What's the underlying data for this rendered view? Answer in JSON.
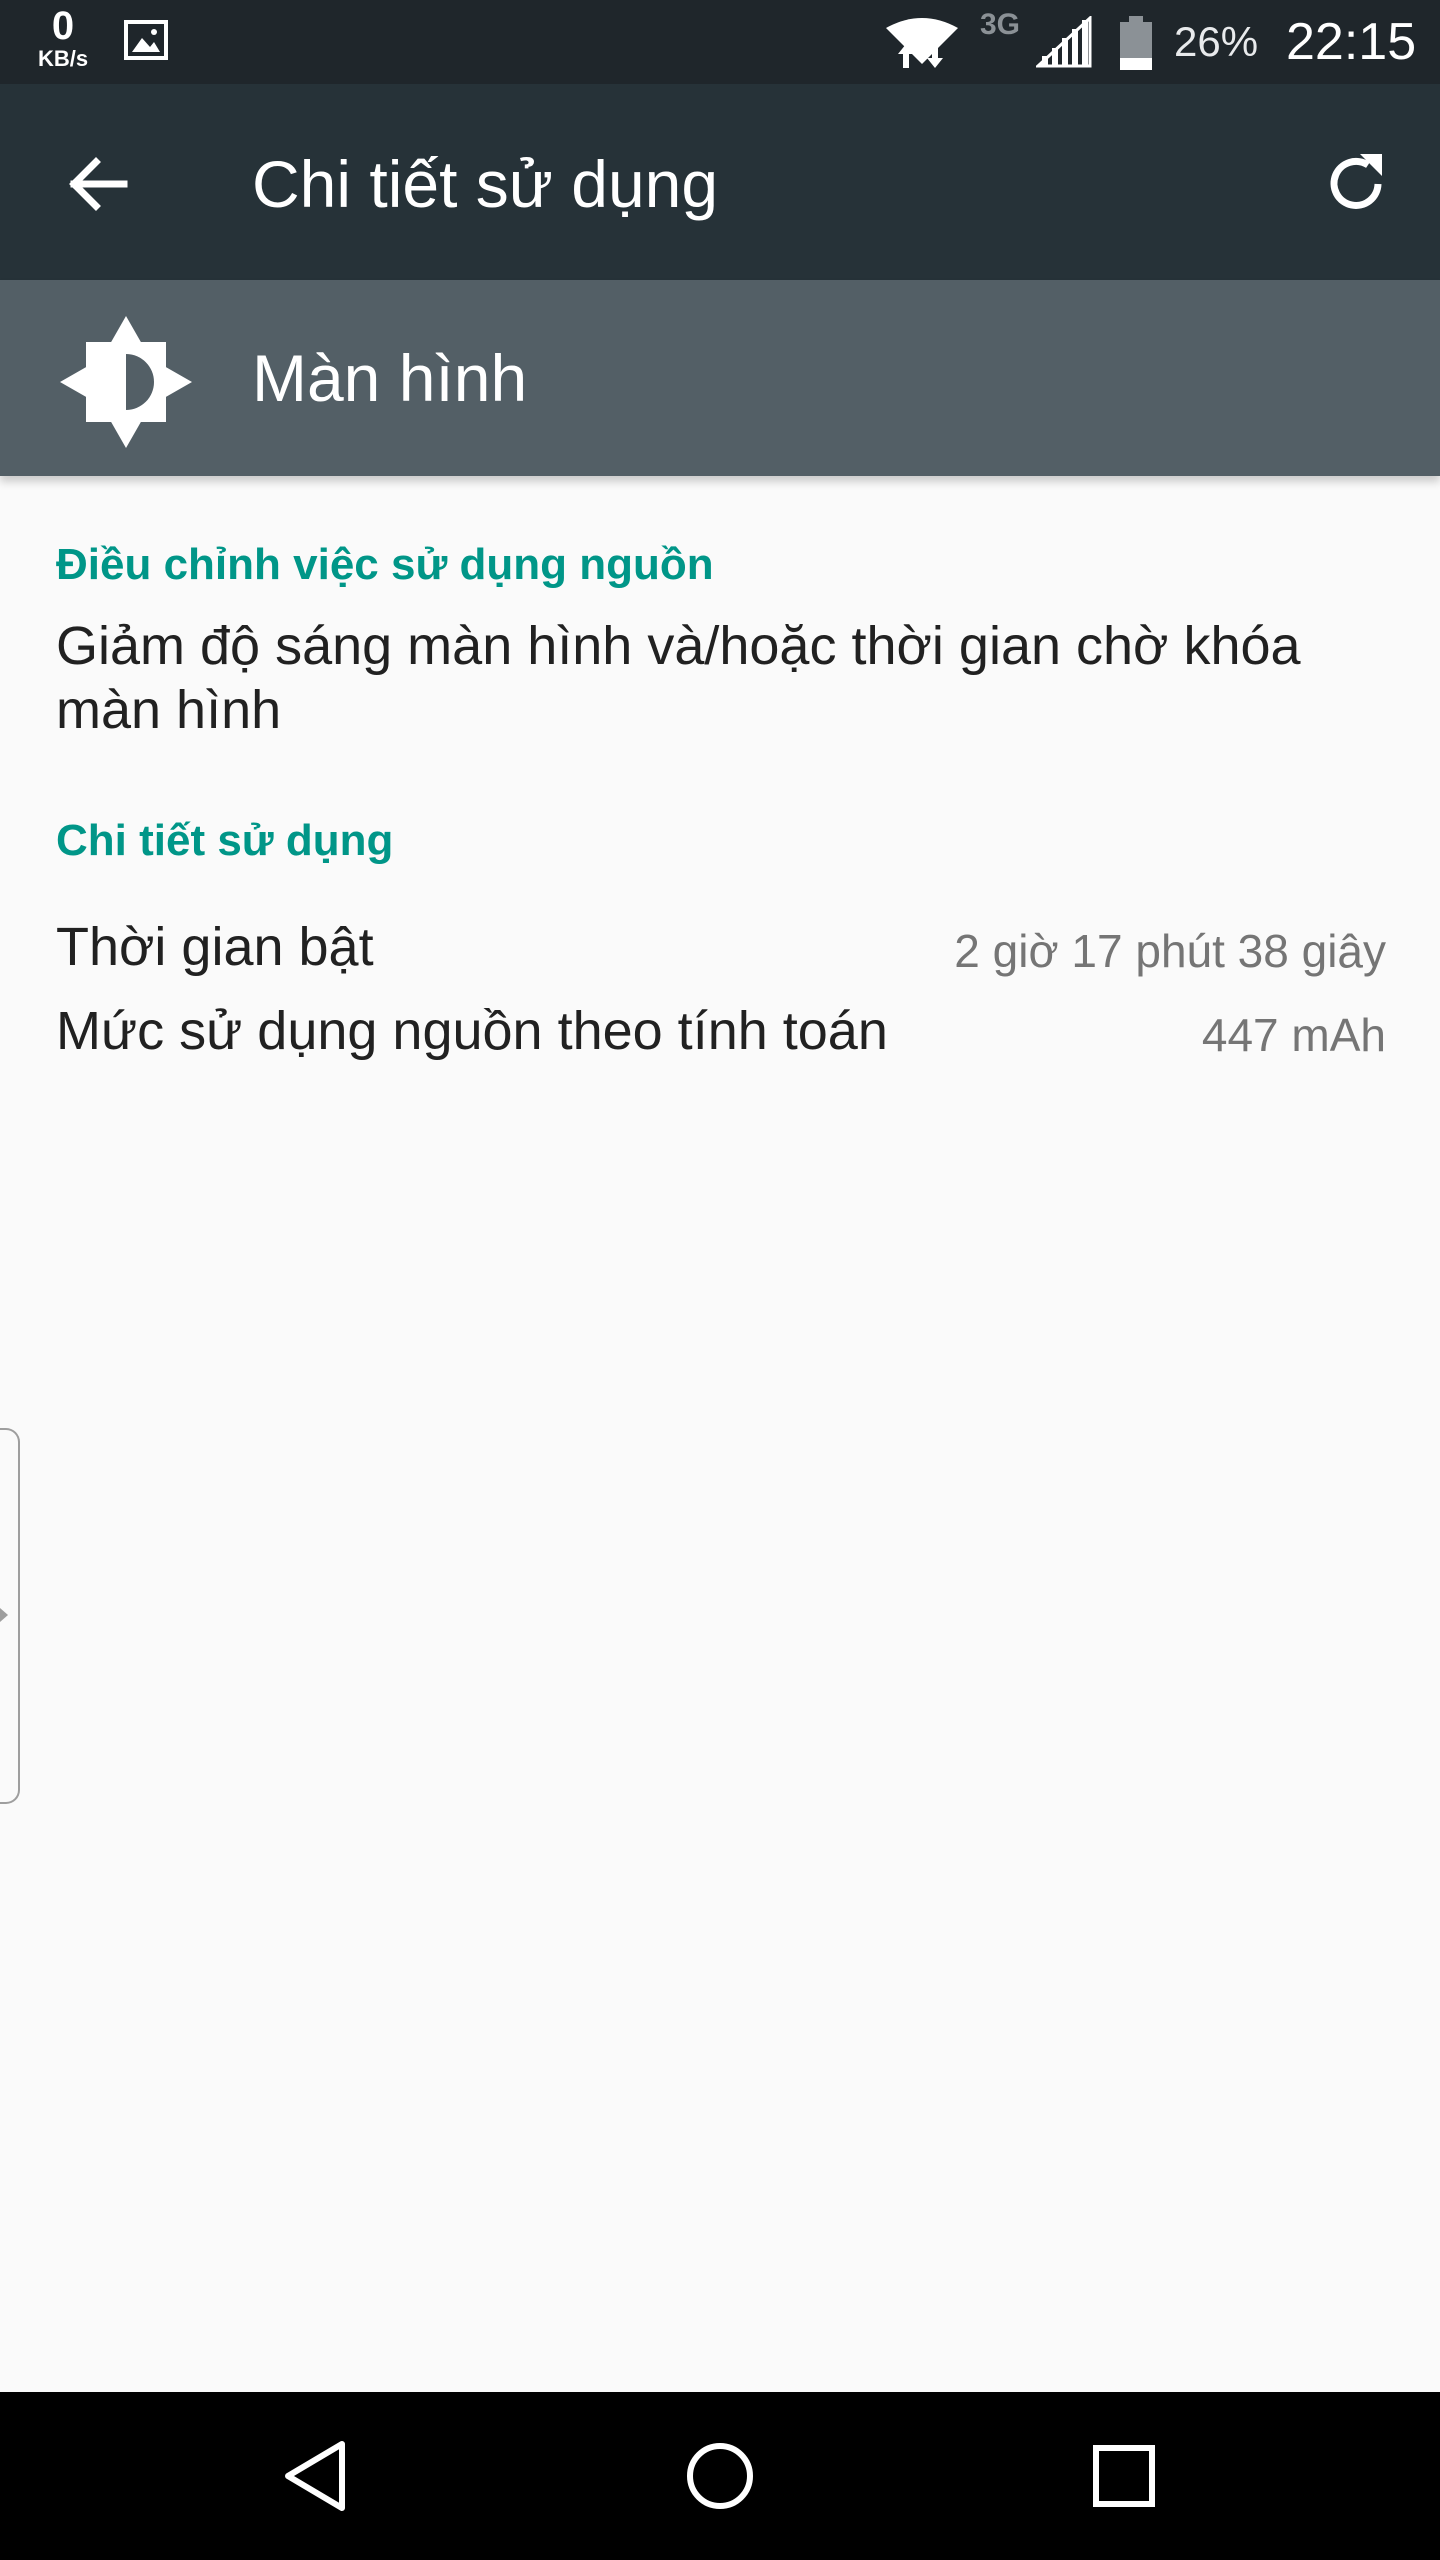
{
  "status_bar": {
    "net_speed_value": "0",
    "net_speed_unit": "KB/s",
    "network_type": "3G",
    "battery_percent": "26%",
    "time": "22:15",
    "icons": [
      "image-notification-icon",
      "wifi-icon",
      "signal-icon",
      "battery-icon"
    ]
  },
  "app_bar": {
    "title": "Chi tiết sử dụng",
    "back_icon": "arrow-back-icon",
    "refresh_icon": "refresh-icon"
  },
  "header": {
    "icon": "brightness-icon",
    "title": "Màn hình"
  },
  "sections": {
    "adjust_title": "Điều chỉnh việc sử dụng nguồn",
    "adjust_text": "Giảm độ sáng màn hình và/hoặc thời gian chờ khóa màn hình",
    "usage_title": "Chi tiết sử dụng",
    "usage_rows": [
      {
        "label": "Thời gian bật",
        "value": "2 giờ 17 phút 38 giây"
      },
      {
        "label": "Mức sử dụng nguồn theo tính toán",
        "value": "447 mAh"
      }
    ]
  },
  "nav_bar": {
    "icons": [
      "nav-back-icon",
      "nav-home-icon",
      "nav-recents-icon"
    ]
  },
  "colors": {
    "status_bar": "#1f262b",
    "app_bar": "#263238",
    "header": "#535f66",
    "accent": "#009688",
    "background": "#fafafa"
  }
}
